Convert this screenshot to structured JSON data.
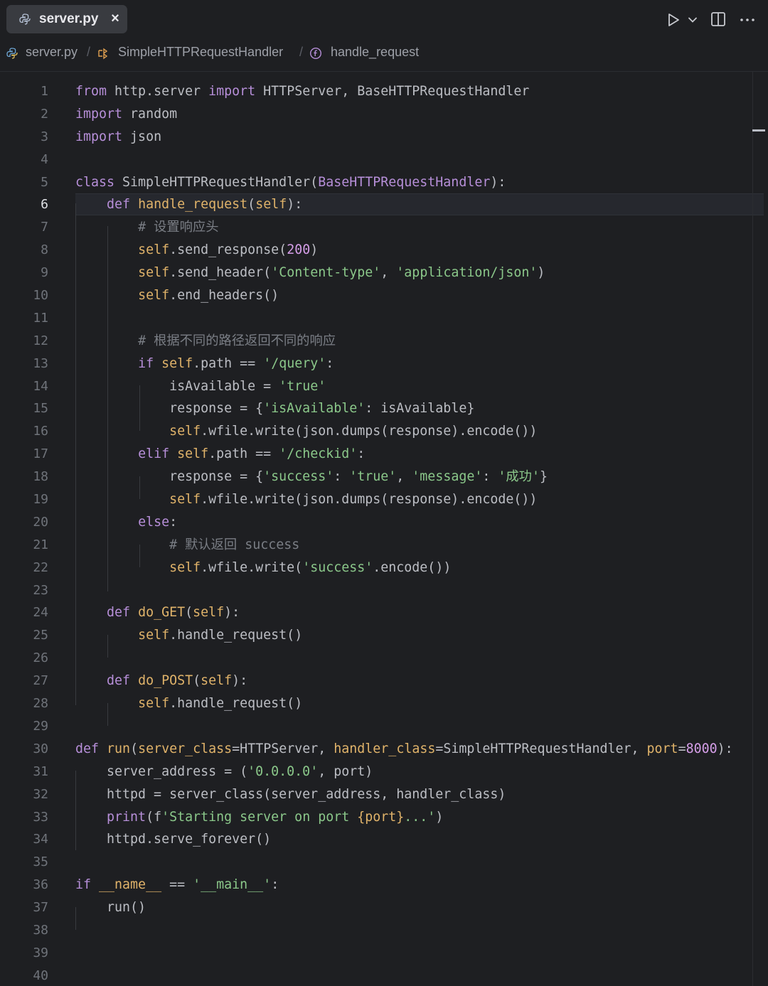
{
  "tab": {
    "label": "server.py",
    "close": "×"
  },
  "breadcrumb": {
    "file": "server.py",
    "class": "SimpleHTTPRequestHandler",
    "method": "handle_request",
    "sep": "/"
  },
  "toolbar": {
    "run": "run-icon",
    "dropdown": "chevron-down-icon",
    "split": "split-editor-icon",
    "more": "more-icon"
  },
  "editor": {
    "active_line": 6,
    "line_numbers": [
      "1",
      "2",
      "3",
      "4",
      "5",
      "6",
      "7",
      "8",
      "9",
      "10",
      "11",
      "12",
      "13",
      "14",
      "15",
      "16",
      "17",
      "18",
      "19",
      "20",
      "21",
      "22",
      "23",
      "24",
      "25",
      "26",
      "27",
      "28",
      "29",
      "30",
      "31",
      "32",
      "33",
      "34",
      "35",
      "36",
      "37",
      "38",
      "39",
      "40"
    ],
    "lines": [
      [
        [
          "kw2",
          "from"
        ],
        [
          "plain",
          " http.server "
        ],
        [
          "kw2",
          "import"
        ],
        [
          "plain",
          " HTTPServer, BaseHTTPRequestHandler"
        ]
      ],
      [
        [
          "kw2",
          "import"
        ],
        [
          "plain",
          " random"
        ]
      ],
      [
        [
          "kw2",
          "import"
        ],
        [
          "plain",
          " json"
        ]
      ],
      [],
      [
        [
          "kw2",
          "class"
        ],
        [
          "plain",
          " SimpleHTTPRequestHandler("
        ],
        [
          "base",
          "BaseHTTPRequestHandler"
        ],
        [
          "plain",
          "):"
        ]
      ],
      [
        [
          "plain",
          "    "
        ],
        [
          "kw2",
          "def"
        ],
        [
          "plain",
          " "
        ],
        [
          "fn",
          "handle_request"
        ],
        [
          "plain",
          "("
        ],
        [
          "self",
          "self"
        ],
        [
          "plain",
          "):"
        ]
      ],
      [
        [
          "plain",
          "        "
        ],
        [
          "cmt",
          "# 设置响应头"
        ]
      ],
      [
        [
          "plain",
          "        "
        ],
        [
          "self",
          "self"
        ],
        [
          "plain",
          ".send_response("
        ],
        [
          "num",
          "200"
        ],
        [
          "plain",
          ")"
        ]
      ],
      [
        [
          "plain",
          "        "
        ],
        [
          "self",
          "self"
        ],
        [
          "plain",
          ".send_header("
        ],
        [
          "str",
          "'Content-type'"
        ],
        [
          "plain",
          ", "
        ],
        [
          "str",
          "'application/json'"
        ],
        [
          "plain",
          ")"
        ]
      ],
      [
        [
          "plain",
          "        "
        ],
        [
          "self",
          "self"
        ],
        [
          "plain",
          ".end_headers()"
        ]
      ],
      [],
      [
        [
          "plain",
          "        "
        ],
        [
          "cmt",
          "# 根据不同的路径返回不同的响应"
        ]
      ],
      [
        [
          "plain",
          "        "
        ],
        [
          "kw2",
          "if"
        ],
        [
          "plain",
          " "
        ],
        [
          "self",
          "self"
        ],
        [
          "plain",
          ".path == "
        ],
        [
          "str",
          "'/query'"
        ],
        [
          "plain",
          ":"
        ]
      ],
      [
        [
          "plain",
          "            isAvailable = "
        ],
        [
          "str",
          "'true'"
        ]
      ],
      [
        [
          "plain",
          "            response = {"
        ],
        [
          "str",
          "'isAvailable'"
        ],
        [
          "plain",
          ": isAvailable}"
        ]
      ],
      [
        [
          "plain",
          "            "
        ],
        [
          "self",
          "self"
        ],
        [
          "plain",
          ".wfile.write(json.dumps(response).encode())"
        ]
      ],
      [
        [
          "plain",
          "        "
        ],
        [
          "kw2",
          "elif"
        ],
        [
          "plain",
          " "
        ],
        [
          "self",
          "self"
        ],
        [
          "plain",
          ".path == "
        ],
        [
          "str",
          "'/checkid'"
        ],
        [
          "plain",
          ":"
        ]
      ],
      [
        [
          "plain",
          "            response = {"
        ],
        [
          "str",
          "'success'"
        ],
        [
          "plain",
          ": "
        ],
        [
          "str",
          "'true'"
        ],
        [
          "plain",
          ", "
        ],
        [
          "str",
          "'message'"
        ],
        [
          "plain",
          ": "
        ],
        [
          "str",
          "'成功'"
        ],
        [
          "plain",
          "}"
        ]
      ],
      [
        [
          "plain",
          "            "
        ],
        [
          "self",
          "self"
        ],
        [
          "plain",
          ".wfile.write(json.dumps(response).encode())"
        ]
      ],
      [
        [
          "plain",
          "        "
        ],
        [
          "kw2",
          "else"
        ],
        [
          "plain",
          ":"
        ]
      ],
      [
        [
          "plain",
          "            "
        ],
        [
          "cmt",
          "# 默认返回 success"
        ]
      ],
      [
        [
          "plain",
          "            "
        ],
        [
          "self",
          "self"
        ],
        [
          "plain",
          ".wfile.write("
        ],
        [
          "str",
          "'success'"
        ],
        [
          "plain",
          ".encode())"
        ]
      ],
      [],
      [
        [
          "plain",
          "    "
        ],
        [
          "kw2",
          "def"
        ],
        [
          "plain",
          " "
        ],
        [
          "fn",
          "do_GET"
        ],
        [
          "plain",
          "("
        ],
        [
          "self",
          "self"
        ],
        [
          "plain",
          "):"
        ]
      ],
      [
        [
          "plain",
          "        "
        ],
        [
          "self",
          "self"
        ],
        [
          "plain",
          ".handle_request()"
        ]
      ],
      [],
      [
        [
          "plain",
          "    "
        ],
        [
          "kw2",
          "def"
        ],
        [
          "plain",
          " "
        ],
        [
          "fn",
          "do_POST"
        ],
        [
          "plain",
          "("
        ],
        [
          "self",
          "self"
        ],
        [
          "plain",
          "):"
        ]
      ],
      [
        [
          "plain",
          "        "
        ],
        [
          "self",
          "self"
        ],
        [
          "plain",
          ".handle_request()"
        ]
      ],
      [],
      [
        [
          "kw2",
          "def"
        ],
        [
          "plain",
          " "
        ],
        [
          "fn",
          "run"
        ],
        [
          "plain",
          "("
        ],
        [
          "param",
          "server_class"
        ],
        [
          "plain",
          "=HTTPServer, "
        ],
        [
          "param",
          "handler_class"
        ],
        [
          "plain",
          "=SimpleHTTPRequestHandler, "
        ],
        [
          "param",
          "port"
        ],
        [
          "plain",
          "="
        ],
        [
          "num",
          "8000"
        ],
        [
          "plain",
          "):"
        ]
      ],
      [
        [
          "plain",
          "    server_address = ("
        ],
        [
          "str",
          "'0.0.0.0'"
        ],
        [
          "plain",
          ", port)"
        ]
      ],
      [
        [
          "plain",
          "    httpd = server_class(server_address, handler_class)"
        ]
      ],
      [
        [
          "plain",
          "    "
        ],
        [
          "kw2",
          "print"
        ],
        [
          "plain",
          "(f"
        ],
        [
          "str",
          "'Starting server on port "
        ],
        [
          "fn",
          "{port}"
        ],
        [
          "str",
          "...'"
        ],
        [
          "plain",
          ")"
        ]
      ],
      [
        [
          "plain",
          "    httpd.serve_forever()"
        ]
      ],
      [],
      [
        [
          "kw2",
          "if"
        ],
        [
          "plain",
          " "
        ],
        [
          "fn",
          "__name__"
        ],
        [
          "plain",
          " == "
        ],
        [
          "str",
          "'__main__'"
        ],
        [
          "plain",
          ":"
        ]
      ],
      [
        [
          "plain",
          "    run()"
        ]
      ],
      [],
      [],
      []
    ]
  },
  "colors": {
    "background": "#1e1f22",
    "keyword": "#b78fd9",
    "function": "#e0b36a",
    "string": "#8bc88a",
    "number": "#d59ee8",
    "comment": "#7a7e85",
    "text": "#bcbec4"
  }
}
